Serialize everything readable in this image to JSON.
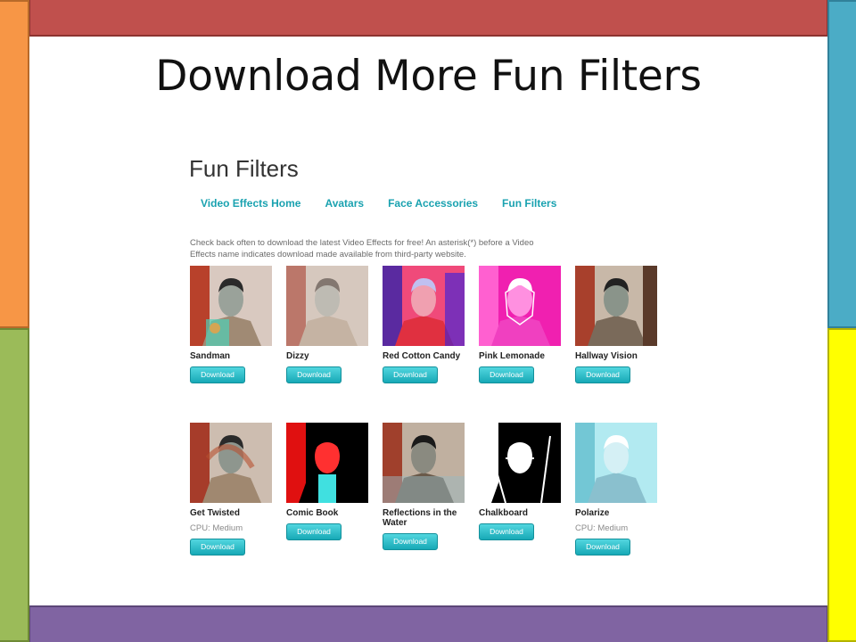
{
  "slide": {
    "title": "Download More Fun Filters"
  },
  "frame_colors": {
    "top": "#c0504d",
    "bottom": "#8064a2",
    "left_top": "#f79646",
    "left_bottom": "#9bbb59",
    "right_top": "#4bacc6",
    "right_bottom": "#ffff00"
  },
  "page": {
    "title": "Fun Filters",
    "nav": [
      "Video Effects Home",
      "Avatars",
      "Face Accessories",
      "Fun Filters"
    ],
    "intro": "Check back often to download the latest Video Effects for free! An asterisk(*) before a Video Effects name indicates download made available from third-party website.",
    "download_label": "Download",
    "accent_color": "#1aa2b0"
  },
  "filters": [
    {
      "name": "Sandman",
      "cpu": ""
    },
    {
      "name": "Dizzy",
      "cpu": ""
    },
    {
      "name": "Red Cotton Candy",
      "cpu": ""
    },
    {
      "name": "Pink Lemonade",
      "cpu": ""
    },
    {
      "name": "Hallway Vision",
      "cpu": ""
    },
    {
      "name": "Get Twisted",
      "cpu": "CPU: Medium"
    },
    {
      "name": "Comic Book",
      "cpu": ""
    },
    {
      "name": "Reflections in the Water",
      "cpu": ""
    },
    {
      "name": "Chalkboard",
      "cpu": ""
    },
    {
      "name": "Polarize",
      "cpu": "CPU: Medium"
    }
  ]
}
